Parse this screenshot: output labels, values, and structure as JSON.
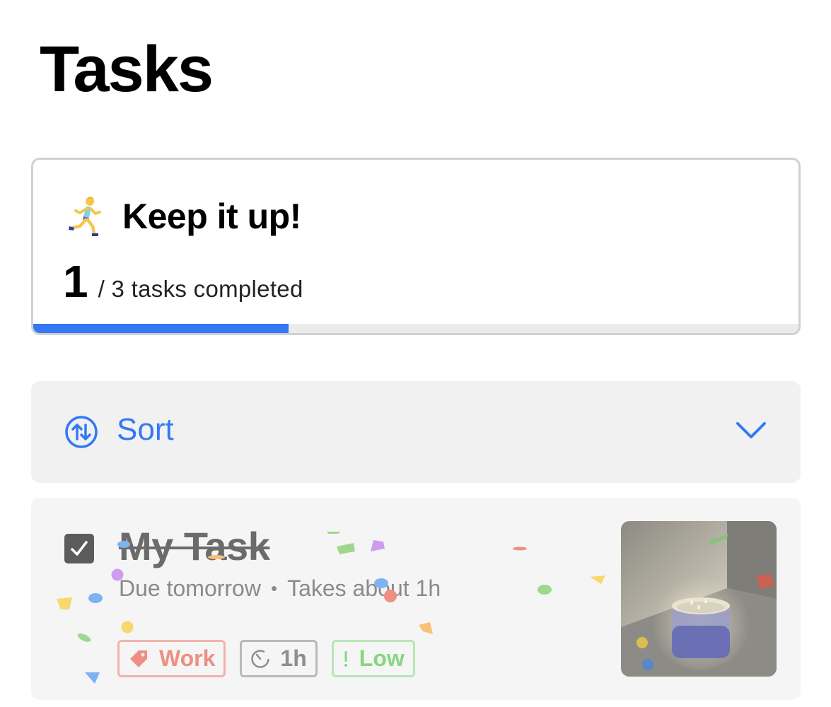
{
  "page": {
    "title": "Tasks"
  },
  "progress_card": {
    "title": "Keep it up!",
    "icon": "woman-running-icon",
    "completed": "1",
    "summary": "/ 3 tasks completed",
    "progress_fraction": 0.3333,
    "accent_color": "#3478f6"
  },
  "sort": {
    "label": "Sort",
    "icon": "sort-arrows-icon",
    "chevron": "chevron-down-icon",
    "accent_color": "#3478f6"
  },
  "task": {
    "title": "My Task",
    "completed": true,
    "due": "Due tomorrow",
    "separator": "•",
    "duration_text": "Takes about 1h",
    "tags": [
      {
        "label": "Work",
        "icon": "tag-icon",
        "color": "#ec8f84"
      },
      {
        "label": "1h",
        "icon": "timer-icon",
        "color": "#8e8e8e"
      },
      {
        "label": "Low",
        "icon": "exclamation-icon",
        "color": "#86d682"
      }
    ],
    "thumbnail": "candle-photo"
  }
}
